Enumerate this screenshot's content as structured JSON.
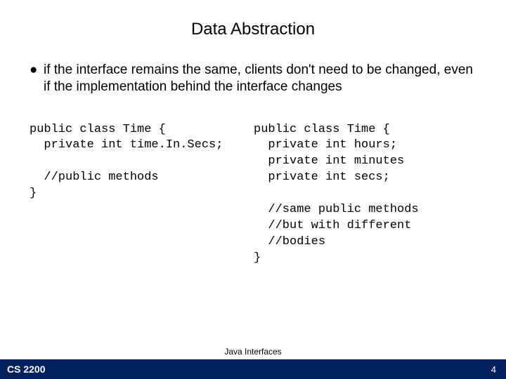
{
  "title": "Data Abstraction",
  "bullet": {
    "marker": "●",
    "text": "if the interface remains the same, clients don't need to be changed, even if the implementation behind the interface changes"
  },
  "code": {
    "left": "public class Time {\n  private int time.In.Secs;\n\n  //public methods\n}",
    "right": "public class Time {\n  private int hours;\n  private int minutes\n  private int secs;\n\n  //same public methods\n  //but with different\n  //bodies\n}"
  },
  "footer": {
    "course": "CS 2200",
    "center": "Java Interfaces",
    "page": "4"
  }
}
